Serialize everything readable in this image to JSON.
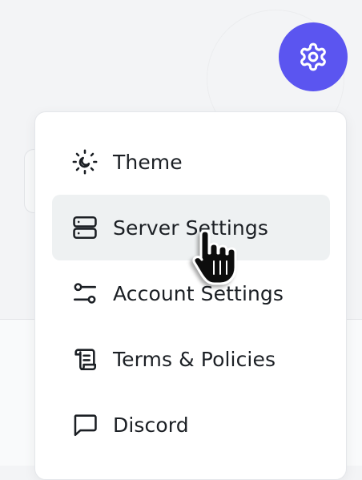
{
  "settings_button": {
    "icon": "gear-icon",
    "color": "#5b55f0"
  },
  "menu": {
    "items": [
      {
        "label": "Theme",
        "icon": "theme-sun-moon-icon"
      },
      {
        "label": "Server Settings",
        "icon": "server-icon",
        "hovered": true
      },
      {
        "label": "Account Settings",
        "icon": "sliders-icon"
      },
      {
        "label": "Terms & Policies",
        "icon": "scroll-icon"
      },
      {
        "label": "Discord",
        "icon": "chat-bubble-icon"
      }
    ]
  },
  "cursor": {
    "icon": "hand-pointer-icon"
  }
}
